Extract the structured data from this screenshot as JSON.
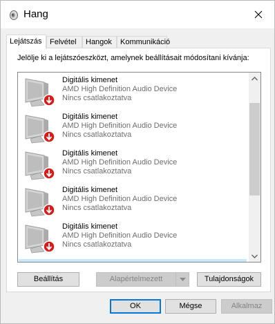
{
  "window": {
    "title": "Hang",
    "close_glyph": "✕"
  },
  "icons": {
    "title": "speaker-icon",
    "close": "close-icon",
    "device": "monitor-icon",
    "status": "disconnected-arrow-icon"
  },
  "colors": {
    "status_red": "#d71b1b",
    "selection": "#cce8ff",
    "accent": "#0078d7"
  },
  "tabs": [
    {
      "label": "Lejátszás",
      "active": true
    },
    {
      "label": "Felvétel",
      "active": false
    },
    {
      "label": "Hangok",
      "active": false
    },
    {
      "label": "Kommunikáció",
      "active": false
    }
  ],
  "panel": {
    "instruction": "Jelölje ki a lejátszóeszközt, amelynek beállításait módosítani kívánja:"
  },
  "devices": [
    {
      "name": "Digitális kimenet",
      "description": "AMD High Definition Audio Device",
      "status": "Nincs csatlakoztatva"
    },
    {
      "name": "Digitális kimenet",
      "description": "AMD High Definition Audio Device",
      "status": "Nincs csatlakoztatva"
    },
    {
      "name": "Digitális kimenet",
      "description": "AMD High Definition Audio Device",
      "status": "Nincs csatlakoztatva"
    },
    {
      "name": "Digitális kimenet",
      "description": "AMD High Definition Audio Device",
      "status": "Nincs csatlakoztatva"
    },
    {
      "name": "Digitális kimenet",
      "description": "AMD High Definition Audio Device",
      "status": "Nincs csatlakoztatva"
    }
  ],
  "buttons": {
    "configure": "Beállítás",
    "set_default": "Alapértelmezett",
    "properties": "Tulajdonságok",
    "ok": "OK",
    "cancel": "Mégse",
    "apply": "Alkalmaz"
  }
}
